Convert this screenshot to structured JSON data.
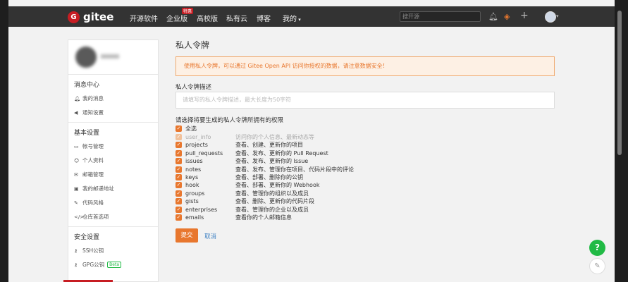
{
  "nav": {
    "logo_text": "gitee",
    "items": [
      "开源软件",
      "企业版",
      "高校版",
      "私有云",
      "博客",
      "我的"
    ],
    "hot_badge": "特惠",
    "search_placeholder": "搜开源"
  },
  "sidebar": {
    "sections": [
      {
        "title": "消息中心",
        "items": [
          {
            "icon": "bell-icon",
            "label": "我的消息"
          },
          {
            "icon": "speaker-icon",
            "label": "通知设置"
          }
        ]
      },
      {
        "title": "基本设置",
        "items": [
          {
            "icon": "card-icon",
            "label": "帐号管理"
          },
          {
            "icon": "person-icon",
            "label": "个人资料"
          },
          {
            "icon": "mail-icon",
            "label": "邮箱管理"
          },
          {
            "icon": "address-icon",
            "label": "我的邮递地址"
          },
          {
            "icon": "brush-icon",
            "label": "代码风格"
          },
          {
            "icon": "code-icon",
            "label": "仓库首选项"
          }
        ]
      },
      {
        "title": "安全设置",
        "items": [
          {
            "icon": "key-icon",
            "label": "SSH公钥"
          },
          {
            "icon": "key-icon",
            "label": "GPG公钥",
            "badge": "Beta"
          }
        ]
      }
    ]
  },
  "main": {
    "title": "私人令牌",
    "warning": "使用私人令牌，可以通过 Gitee Open API 访问你授权的数据，请注意数据安全！",
    "desc_label": "私人令牌描述",
    "desc_placeholder": "请填写的私人令牌描述，最大长度为50字符",
    "perm_label": "请选择将要生成的私人令牌所拥有的权限",
    "select_all": "全选",
    "permissions": [
      {
        "name": "user_info",
        "desc": "访问你的个人信息、最新动态等",
        "disabled": true
      },
      {
        "name": "projects",
        "desc": "查看、创建、更新你的项目"
      },
      {
        "name": "pull_requests",
        "desc": "查看、发布、更新你的 Pull Request"
      },
      {
        "name": "issues",
        "desc": "查看、发布、更新你的 Issue"
      },
      {
        "name": "notes",
        "desc": "查看、发布、管理你在项目、代码片段中的评论"
      },
      {
        "name": "keys",
        "desc": "查看、部署、删除你的公钥"
      },
      {
        "name": "hook",
        "desc": "查看、部署、更新你的 Webhook"
      },
      {
        "name": "groups",
        "desc": "查看、管理你的组织以及成员"
      },
      {
        "name": "gists",
        "desc": "查看、删除、更新你的代码片段"
      },
      {
        "name": "enterprises",
        "desc": "查看、管理你的企业以及成员"
      },
      {
        "name": "emails",
        "desc": "查看你的个人邮箱信息"
      }
    ],
    "submit": "提交",
    "cancel": "取消"
  },
  "floating": {
    "help": "?"
  }
}
